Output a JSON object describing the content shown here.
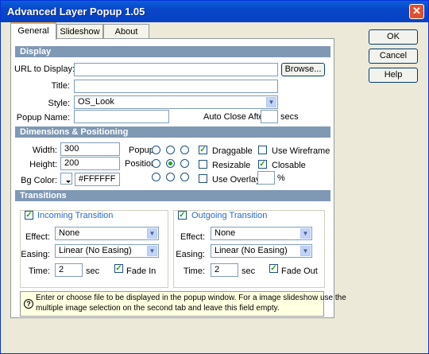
{
  "window": {
    "title": "Advanced Layer Popup 1.05",
    "close_glyph": "✕"
  },
  "tabs": [
    {
      "label": "General"
    },
    {
      "label": "Slideshow"
    },
    {
      "label": "About"
    }
  ],
  "buttons": {
    "ok": "OK",
    "cancel": "Cancel",
    "help": "Help",
    "browse": "Browse..."
  },
  "display": {
    "section": "Display",
    "url_label": "URL to Display:",
    "url_value": "",
    "title_label": "Title:",
    "title_value": "",
    "style_label": "Style:",
    "style_value": "OS_Look",
    "popup_name_label": "Popup Name:",
    "popup_name_value": "",
    "auto_close_label": "Auto Close After",
    "auto_close_value": "",
    "auto_close_unit": "secs"
  },
  "dimensions": {
    "section": "Dimensions & Positioning",
    "width_label": "Width:",
    "width_value": "300",
    "height_label": "Height:",
    "height_value": "200",
    "bgcolor_label": "Bg Color:",
    "bgcolor_value": "#FFFFFF",
    "popup_label": "Popup",
    "position_label": "Position",
    "position_selected": "center",
    "draggable_label": "Draggable",
    "draggable_checked": true,
    "use_wireframe_label": "Use Wireframe",
    "use_wireframe_checked": false,
    "resizable_label": "Resizable",
    "resizable_checked": false,
    "closable_label": "Closable",
    "closable_checked": true,
    "use_overlay_label": "Use Overlay",
    "use_overlay_checked": false,
    "overlay_value": "",
    "percent": "%"
  },
  "transitions": {
    "section": "Transitions",
    "incoming": {
      "title": "Incoming Transition",
      "enabled": true,
      "effect_label": "Effect:",
      "effect_value": "None",
      "easing_label": "Easing:",
      "easing_value": "Linear (No Easing)",
      "time_label": "Time:",
      "time_value": "2",
      "time_unit": "sec",
      "fade_label": "Fade In",
      "fade_checked": true
    },
    "outgoing": {
      "title": "Outgoing Transition",
      "enabled": true,
      "effect_label": "Effect:",
      "effect_value": "None",
      "easing_label": "Easing:",
      "easing_value": "Linear (No Easing)",
      "time_label": "Time:",
      "time_value": "2",
      "time_unit": "sec",
      "fade_label": "Fade Out",
      "fade_checked": true
    }
  },
  "help_text": {
    "icon": "question-icon",
    "line1": "Enter or choose file to be displayed in the popup window. For a image slideshow use the",
    "line2": "multiple image selection on the second tab and leave this field empty."
  },
  "glyphs": {
    "check": "✓",
    "dropdown": "▼",
    "question": "?"
  }
}
